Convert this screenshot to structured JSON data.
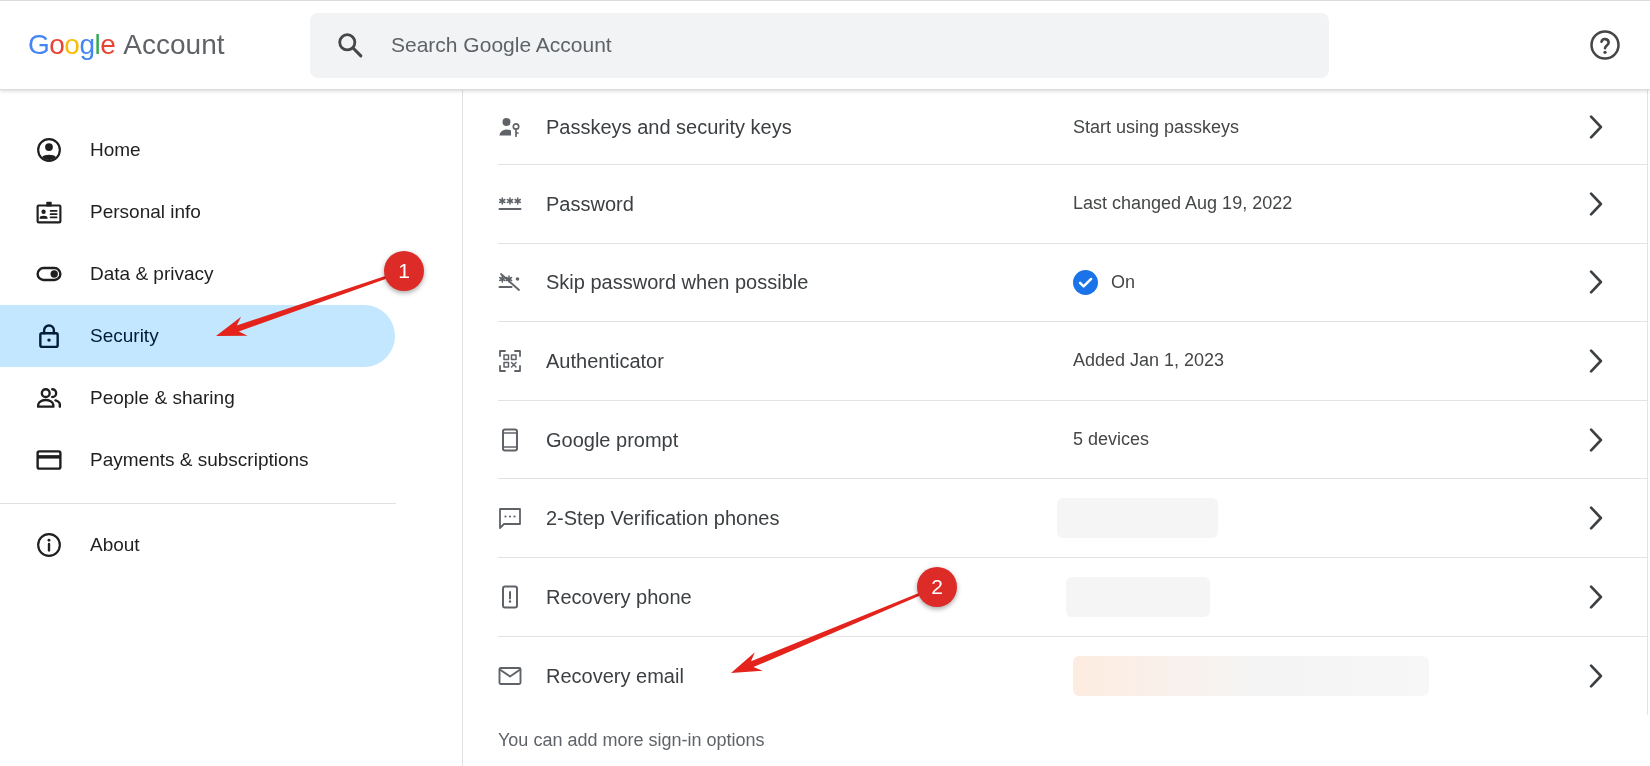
{
  "header": {
    "logo": "Google",
    "product": "Account",
    "search": {
      "placeholder": "Search Google Account"
    }
  },
  "sidebar": {
    "items": [
      {
        "label": "Home",
        "selected": false
      },
      {
        "label": "Personal info",
        "selected": false
      },
      {
        "label": "Data & privacy",
        "selected": false
      },
      {
        "label": "Security",
        "selected": true,
        "callout": "1"
      },
      {
        "label": "People & sharing",
        "selected": false
      },
      {
        "label": "Payments & subscriptions",
        "selected": false
      }
    ],
    "bottom_items": [
      {
        "label": "About",
        "selected": false
      }
    ]
  },
  "sign_in_options": {
    "rows": [
      {
        "kind": "text",
        "title": "Passkeys and security keys",
        "value": "Start using passkeys"
      },
      {
        "kind": "text",
        "title": "Password",
        "value": "Last changed Aug 19, 2022"
      },
      {
        "kind": "status",
        "title": "Skip password when possible",
        "value": "On",
        "checked": true
      },
      {
        "kind": "text",
        "title": "Authenticator",
        "value": "Added Jan 1, 2023"
      },
      {
        "kind": "text",
        "title": "Google prompt",
        "value": "5 devices"
      },
      {
        "kind": "redacted",
        "title": "2-Step Verification phones"
      },
      {
        "kind": "redacted",
        "title": "Recovery phone"
      },
      {
        "kind": "redacted",
        "title": "Recovery email",
        "callout": "2"
      }
    ],
    "footer": "You can add more sign-in options"
  }
}
